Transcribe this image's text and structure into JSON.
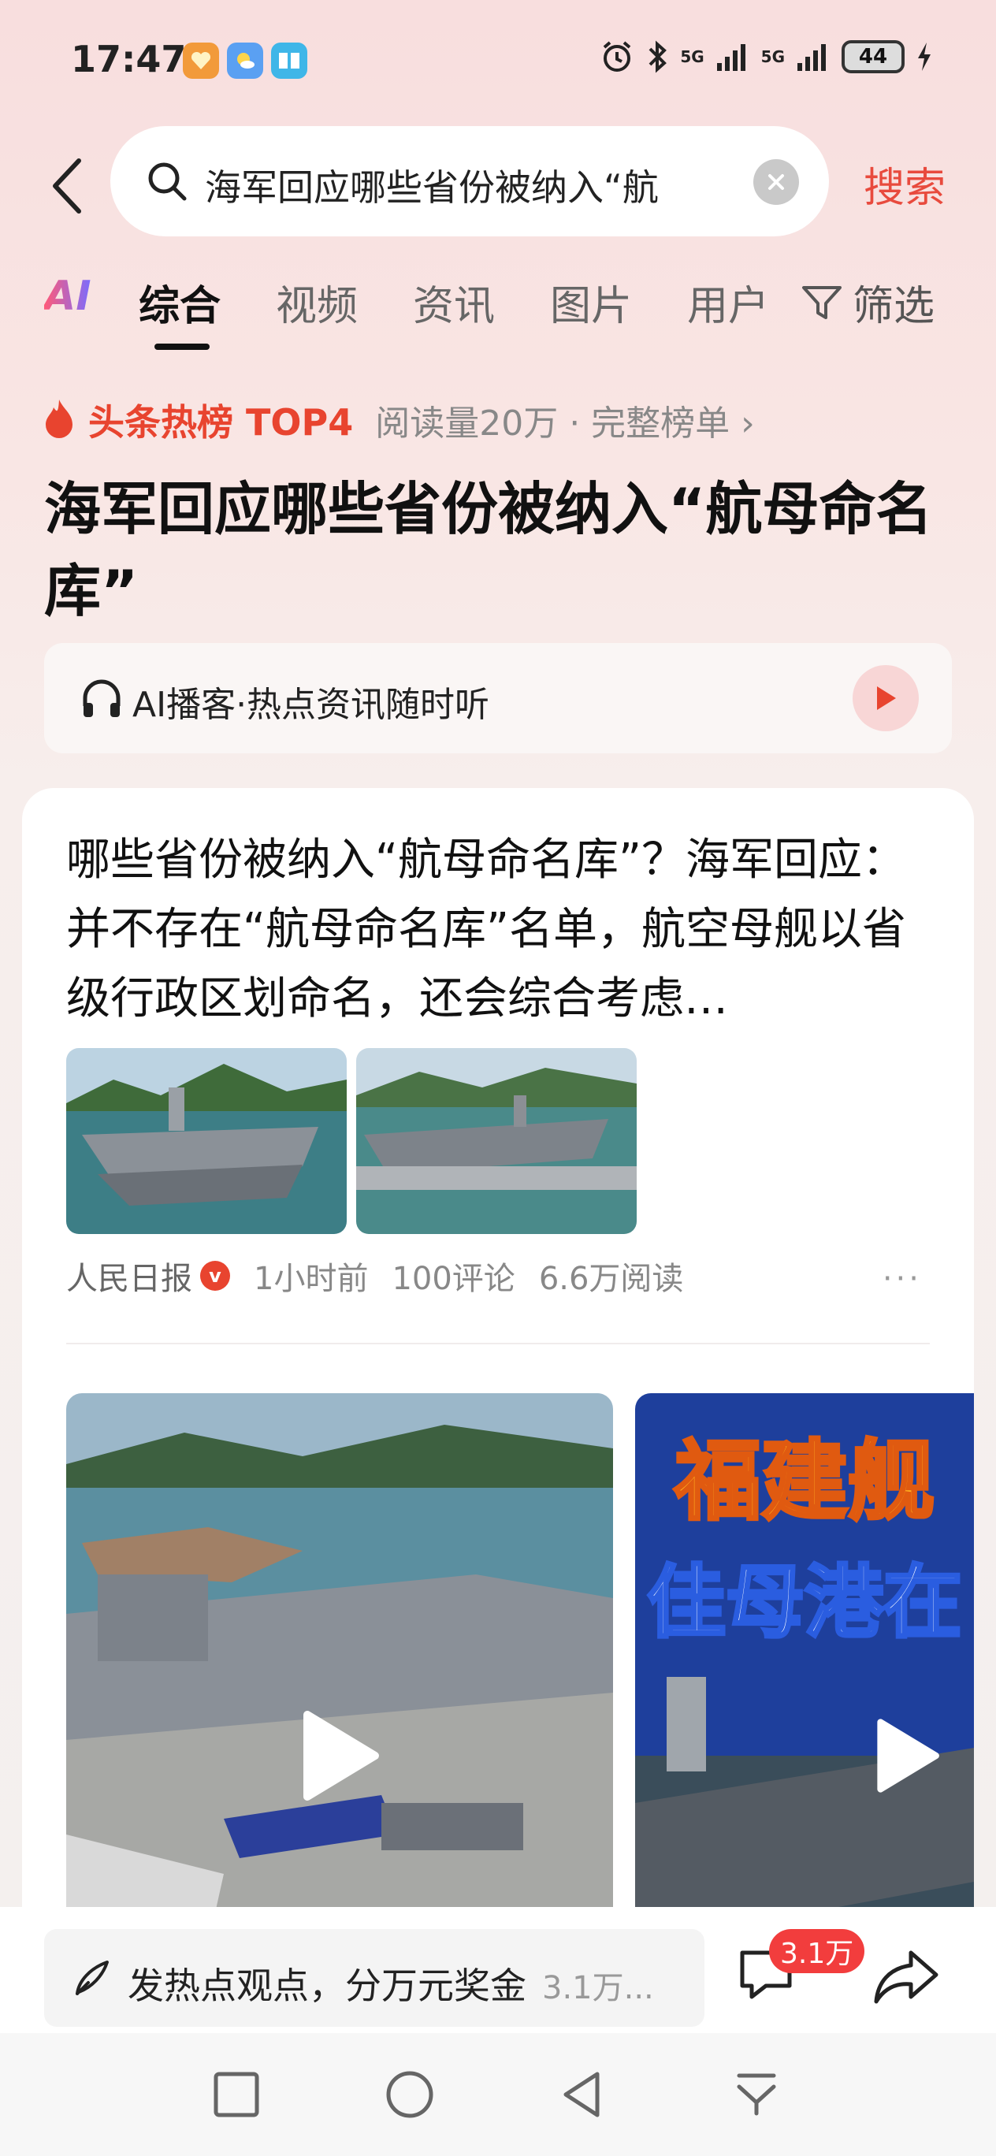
{
  "status_bar": {
    "time": "17:47",
    "signal1": "5G",
    "signal2": "5G",
    "battery": "44"
  },
  "search": {
    "query": "海军回应哪些省份被纳入“航",
    "submit_label": "搜索"
  },
  "tabs": [
    {
      "label": "AI"
    },
    {
      "label": "综合"
    },
    {
      "label": "视频"
    },
    {
      "label": "资讯"
    },
    {
      "label": "图片"
    },
    {
      "label": "用户"
    }
  ],
  "filter_label": "筛选",
  "hot": {
    "label": "头条热榜 TOP4",
    "meta": "阅读量20万 · 完整榜单 ›"
  },
  "topic_title": "海军回应哪些省份被纳入“航母命名库”",
  "podcast": {
    "label": "AI播客·热点资讯随时听"
  },
  "article": {
    "title": "哪些省份被纳入“航母命名库”？海军回应：并不存在“航母命名库”名单，航空母舰以省级行政区划命名，还会综合考虑…",
    "source": "人民日报",
    "verified": "v",
    "time": "1小时前",
    "comments": "100评论",
    "reads": "6.6万阅读",
    "more": "···"
  },
  "video2_overlay": {
    "line1": "福建舰",
    "line2": "佳母港在"
  },
  "bottom": {
    "comment_prompt": "发热点观点，分万元奖金",
    "comment_suffix": "3.1万...",
    "comment_badge": "3.1万"
  },
  "colors": {
    "accent": "#e84a3d",
    "badge": "#f23d3d"
  }
}
